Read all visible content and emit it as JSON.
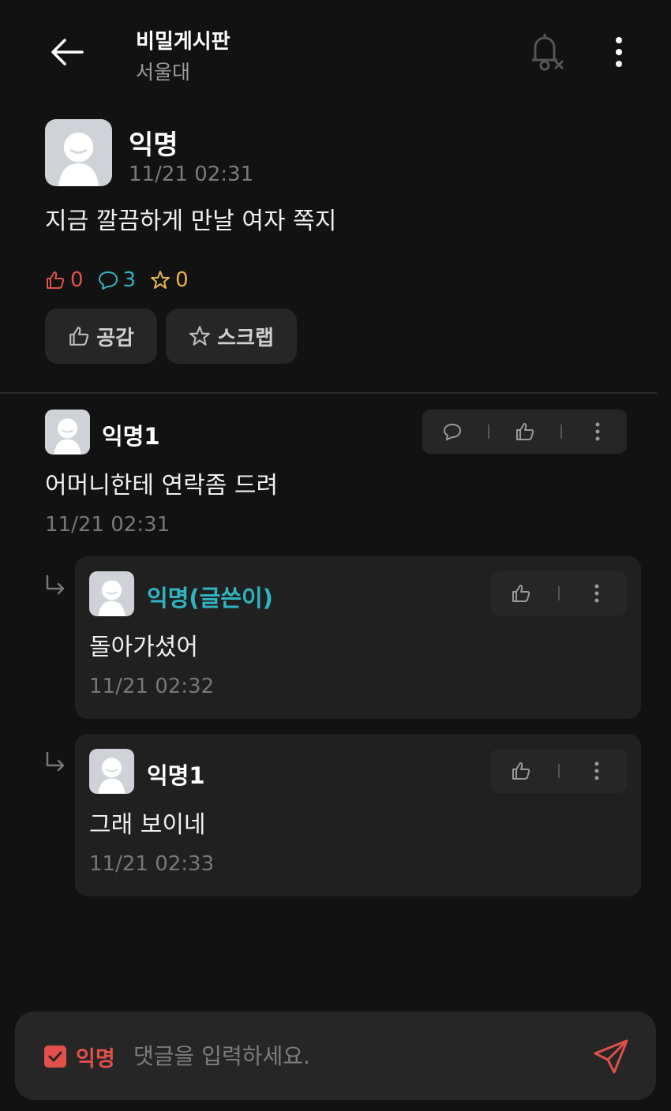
{
  "header": {
    "title": "비밀게시판",
    "subtitle": "서울대"
  },
  "post": {
    "author": "익명",
    "time": "11/21 02:31",
    "body": "지금 깔끔하게 만날 여자 쪽지",
    "likes": "0",
    "comments": "3",
    "scraps": "0",
    "like_button": "공감",
    "scrap_button": "스크랩"
  },
  "comments": [
    {
      "author": "익명1",
      "text": "어머니한테 연락좀 드려",
      "time": "11/21 02:31",
      "replies": [
        {
          "author": "익명(글쓴이)",
          "text": "돌아가셨어",
          "time": "11/21 02:32",
          "is_op": true
        },
        {
          "author": "익명1",
          "text": "그래 보이네",
          "time": "11/21 02:33",
          "is_op": false
        }
      ]
    }
  ],
  "input_bar": {
    "anonymous_label": "익명",
    "anonymous_checked": true,
    "placeholder": "댓글을 입력하세요."
  },
  "colors": {
    "background": "#121212",
    "like": "#e0524a",
    "comment": "#2fb5c1",
    "scrap": "#e8b548",
    "op_author": "#2fb5c1",
    "accent": "#e2504a"
  },
  "icons": [
    "back-arrow-icon",
    "bell-off-icon",
    "more-vertical-icon",
    "thumbs-up-icon",
    "speech-bubble-icon",
    "star-icon",
    "reply-arrow-icon",
    "checkbox-icon",
    "send-icon"
  ]
}
